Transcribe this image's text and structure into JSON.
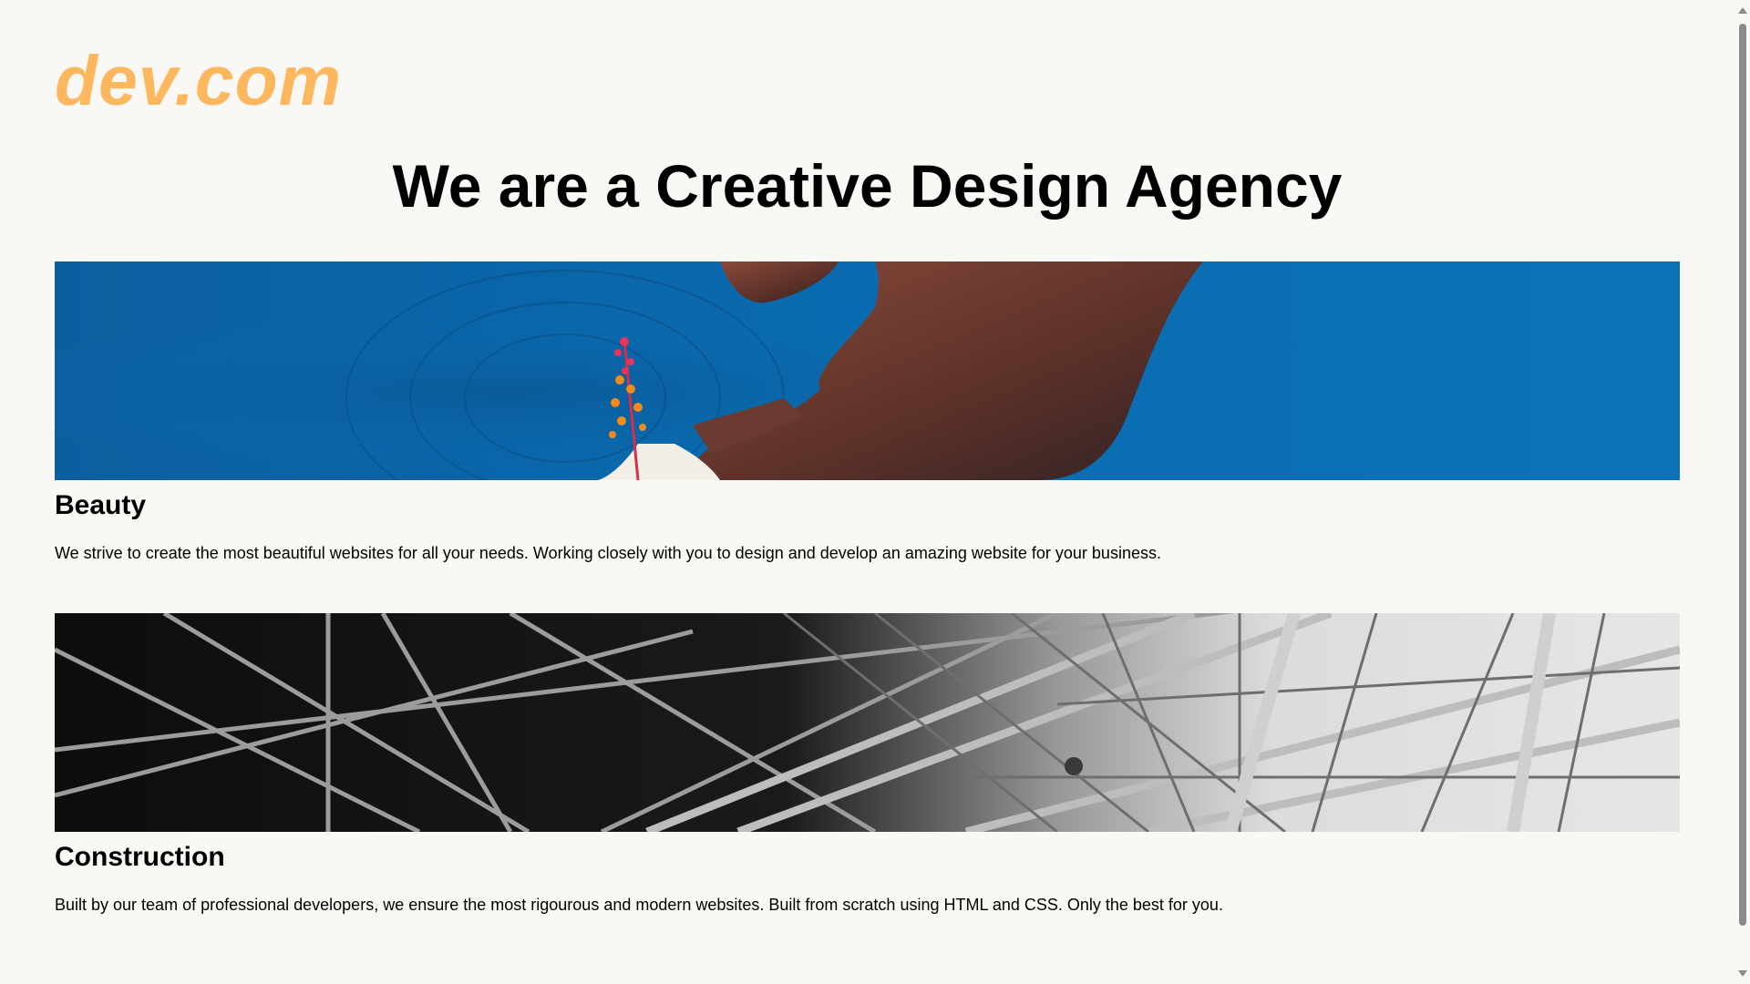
{
  "header": {
    "logo": "dev.com",
    "title": "We are a Creative Design Agency"
  },
  "sections": [
    {
      "image": "hand-with-flower-in-water",
      "heading": "Beauty",
      "text": "We strive to create the most beautiful websites for all your needs. Working closely with you to design and develop an amazing website for your business."
    },
    {
      "image": "steel-structure-construction",
      "heading": "Construction",
      "text": "Built by our team of professional developers, we ensure the most rigourous and modern websites. Built from scratch using HTML and CSS. Only the best for you."
    }
  ],
  "colors": {
    "background": "#f9f8f5",
    "logo": "#fdb75f",
    "water": "#0a6bb0"
  }
}
